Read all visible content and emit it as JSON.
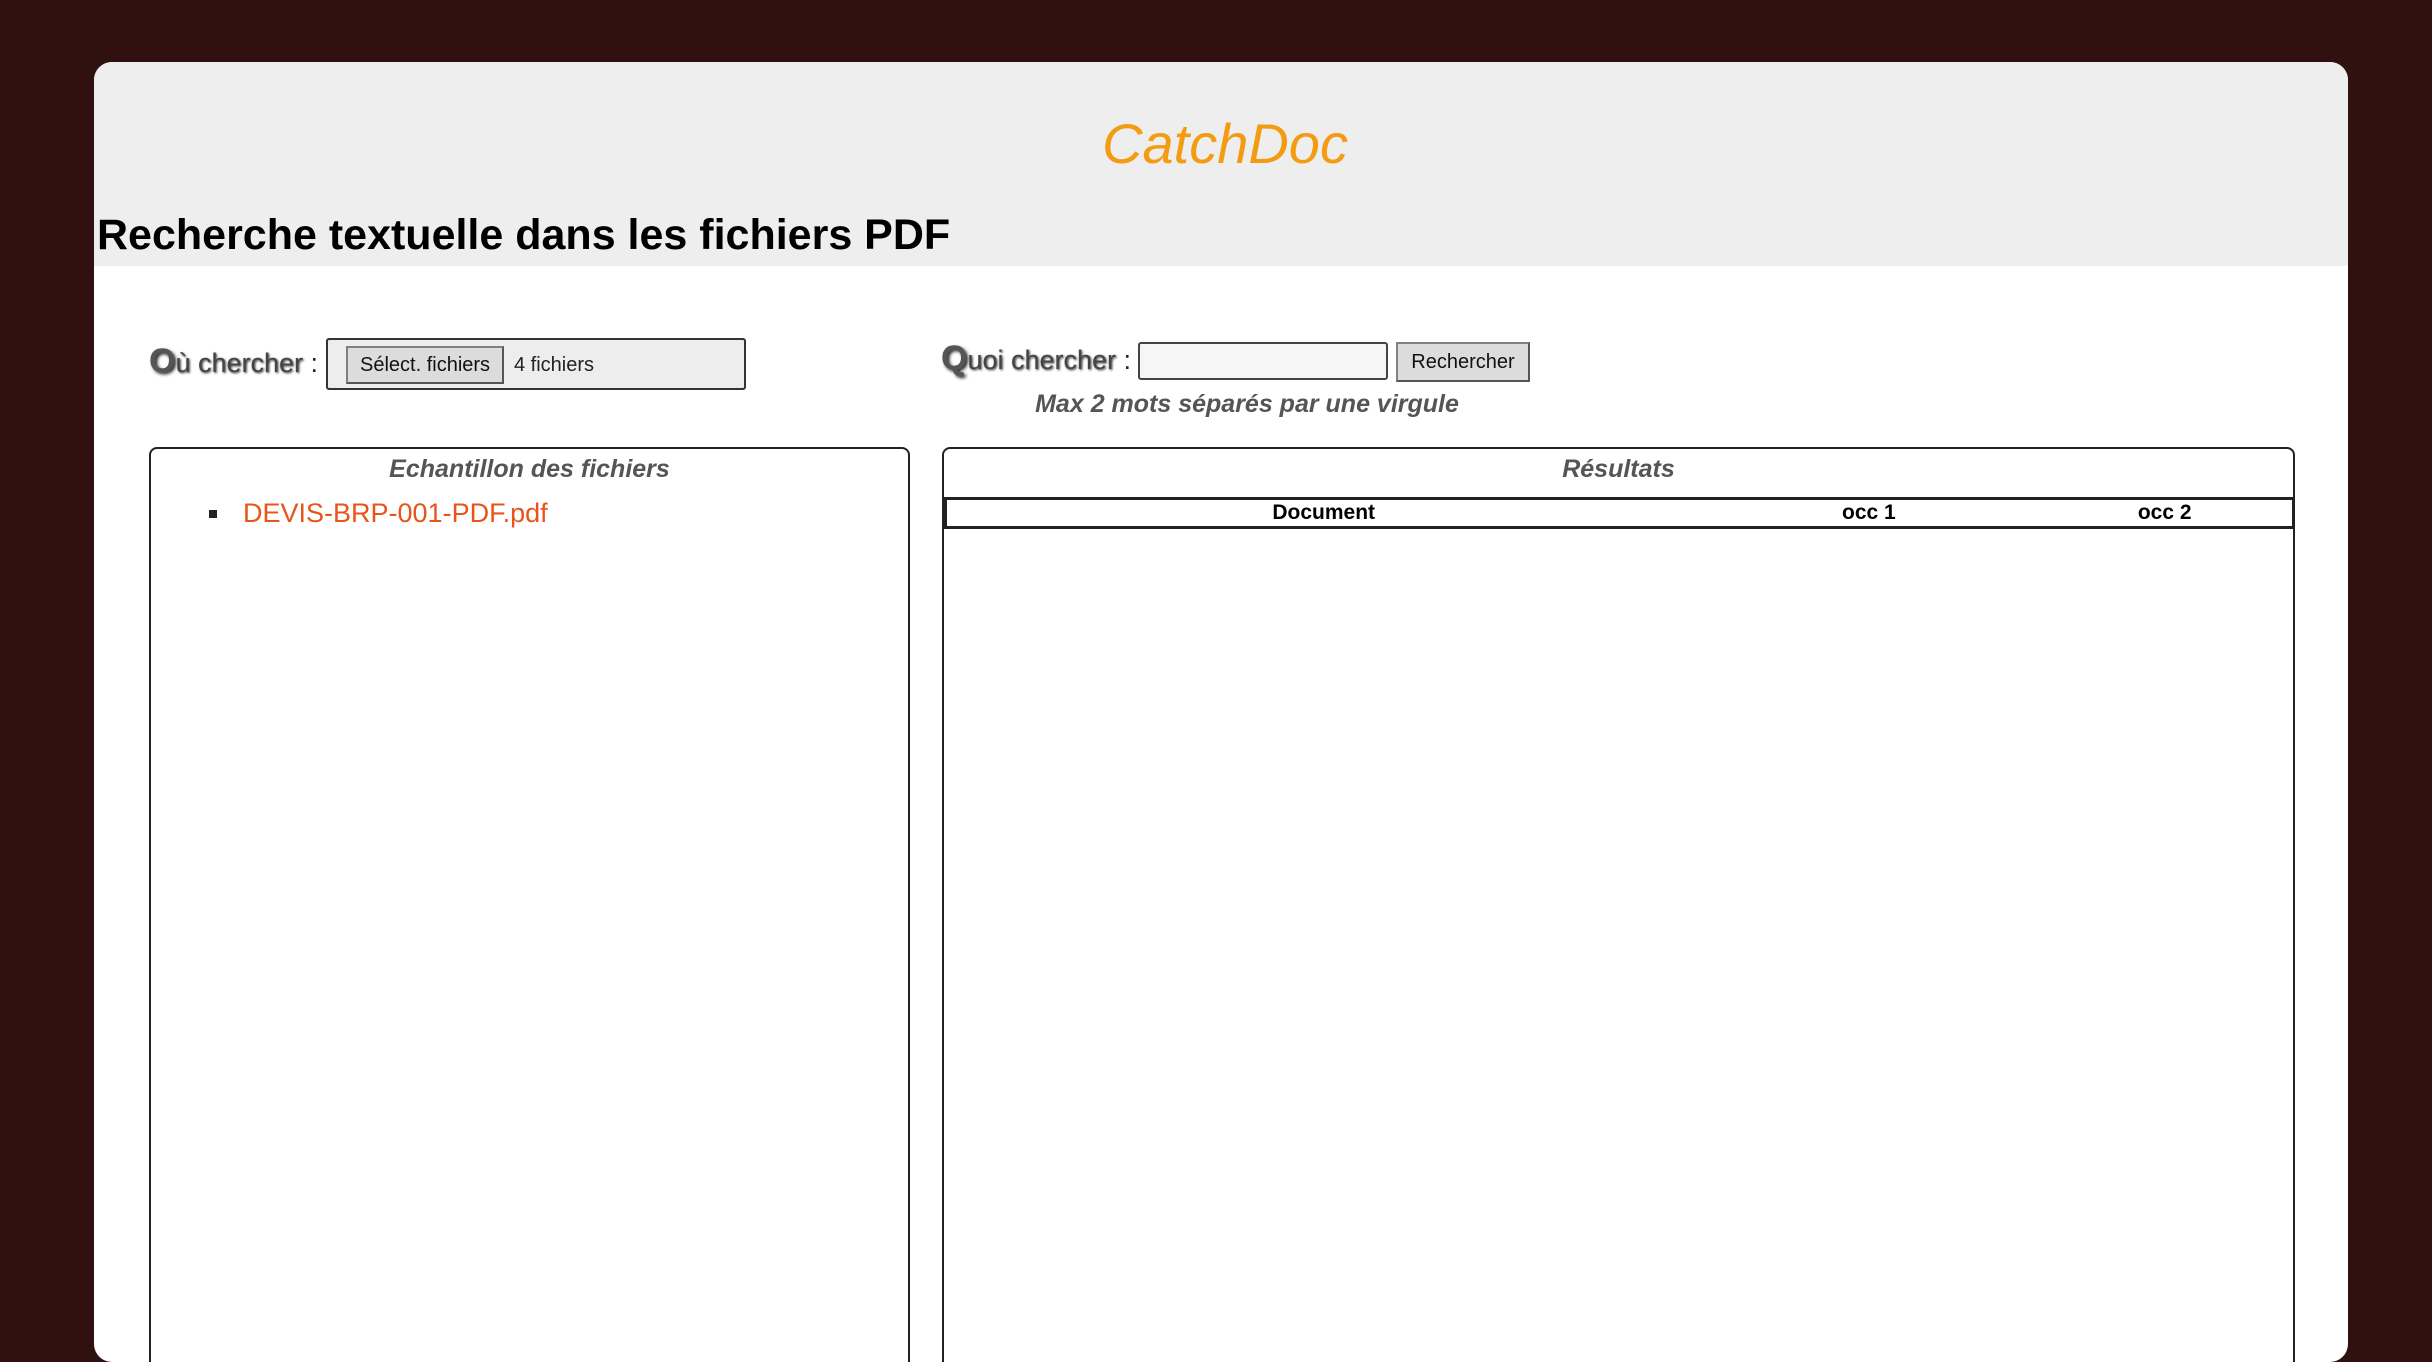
{
  "header": {
    "brand": "CatchDoc",
    "page_title": "Recherche textuelle dans les fichiers PDF"
  },
  "where": {
    "label_initial": "O",
    "label_rest": "ù chercher ",
    "label_colon": ":",
    "file_button": "Sélect. fichiers",
    "file_count": "4 fichiers"
  },
  "what": {
    "label_initial": "Q",
    "label_rest": "uoi chercher ",
    "label_colon": ":",
    "search_value": "",
    "search_button": "Rechercher",
    "hint": "Max 2 mots séparés par une virgule"
  },
  "sample": {
    "title": "Echantillon des fichiers",
    "files": [
      "DEVIS-BRP-001-PDF.pdf"
    ]
  },
  "results": {
    "title": "Résultats",
    "columns": [
      "Document",
      "occ 1",
      "occ 2"
    ],
    "rows": []
  },
  "colors": {
    "background": "#311010",
    "brand": "#f39c12",
    "file_link": "#e8541a"
  }
}
